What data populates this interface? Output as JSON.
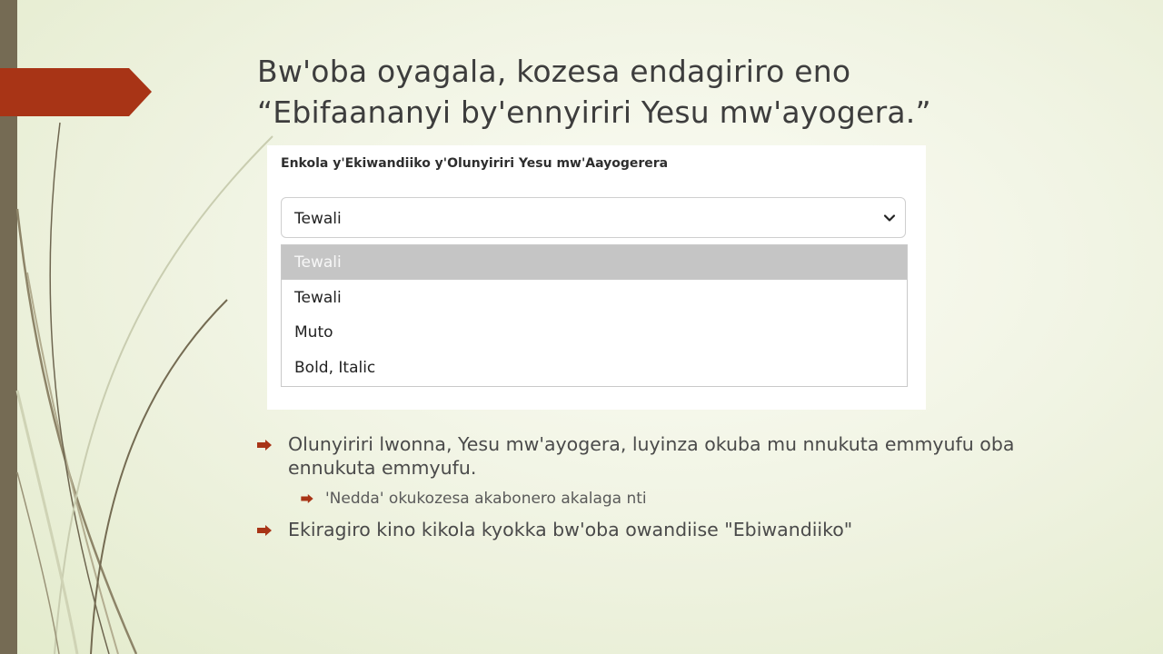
{
  "slide": {
    "title_line1": "Bw'oba oyagala, kozesa endagiriro eno",
    "title_line2": "“Ebifaananyi by'ennyiriri Yesu mw'ayogera.”",
    "accent_color": "#a83416",
    "sidebar_color": "#756b54"
  },
  "panel": {
    "label": "Enkola y'Ekiwandiiko y'Olunyiriri Yesu mw'Aayogerera",
    "select": {
      "value": "Tewali",
      "options": [
        {
          "label": "Tewali",
          "selected": true
        },
        {
          "label": "Tewali",
          "selected": false
        },
        {
          "label": "Muto",
          "selected": false
        },
        {
          "label": "Bold, Italic",
          "selected": false
        }
      ]
    }
  },
  "bullets": [
    {
      "text": "Olunyiriri lwonna, Yesu mw'ayogera, luyinza okuba mu nnukuta emmyufu oba ennukuta emmyufu.",
      "level": 1
    },
    {
      "text": "'Nedda' okukozesa akabonero akalaga nti",
      "level": 2
    },
    {
      "text": "Ekiragiro kino kikola kyokka bw'oba owandiise \"Ebiwandiiko\"",
      "level": 1
    }
  ]
}
